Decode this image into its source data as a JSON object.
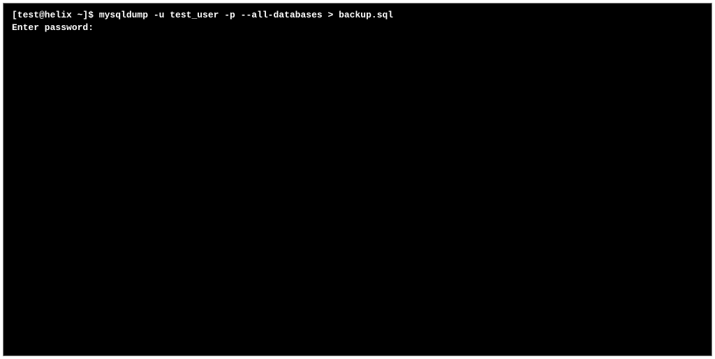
{
  "terminal": {
    "prompt": "[test@helix ~]$ ",
    "command": "mysqldump -u test_user -p --all-databases > backup.sql",
    "passwordPrompt": "Enter password:"
  }
}
